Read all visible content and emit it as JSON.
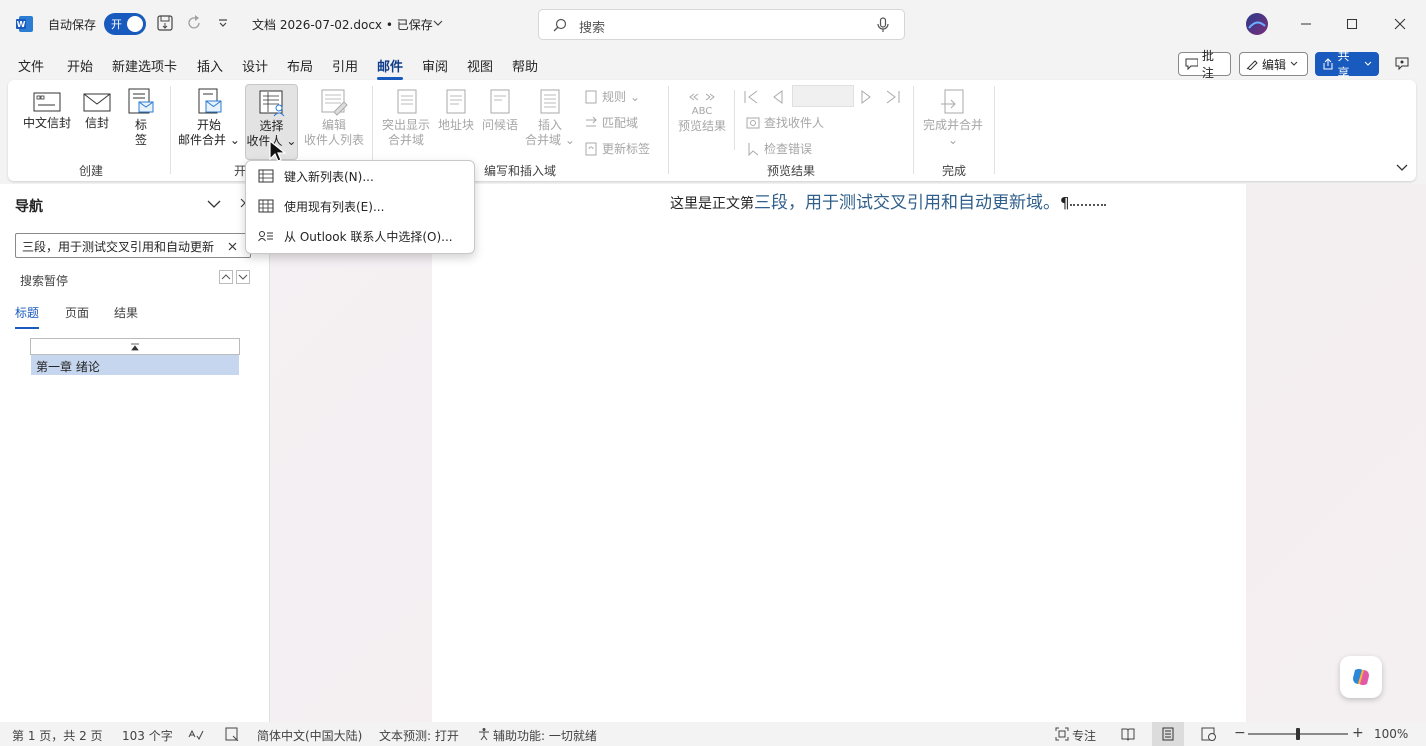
{
  "titlebar": {
    "autosave_label": "自动保存",
    "autosave_state": "开",
    "doc_title": "文档 2026-07-02.docx • 已保存",
    "search_placeholder": "搜索"
  },
  "menu": {
    "items": [
      "文件",
      "开始",
      "新建选项卡",
      "插入",
      "设计",
      "布局",
      "引用",
      "邮件",
      "审阅",
      "视图",
      "帮助"
    ],
    "active": "邮件",
    "comments_label": "批注",
    "editing_label": "编辑",
    "share_label": "共享"
  },
  "ribbon": {
    "create": {
      "group_name": "创建",
      "chinese_envelope": "中文信封",
      "envelope": "信封",
      "labels_1": "标",
      "labels_2": "签"
    },
    "start_merge": {
      "group_name_partial": "开",
      "start_1": "开始",
      "start_2": "邮件合并",
      "select_1": "选择",
      "select_2": "收件人",
      "edit_1": "编辑",
      "edit_2": "收件人列表"
    },
    "write_insert": {
      "group_name": "编写和插入域",
      "highlight_1": "突出显示",
      "highlight_2": "合并域",
      "address_block": "地址块",
      "greeting": "问候语",
      "insert_1": "插入",
      "insert_2": "合并域",
      "rules": "规则",
      "match_fields": "匹配域",
      "update_labels": "更新标签"
    },
    "preview": {
      "group_name": "预览结果",
      "abc": "ABC",
      "preview_results": "预览结果",
      "find_recipient": "查找收件人",
      "check_errors": "检查错误"
    },
    "finish": {
      "group_name": "完成",
      "finish_merge": "完成并合并"
    }
  },
  "dropdown": {
    "items": [
      "键入新列表(N)...",
      "使用现有列表(E)...",
      "从 Outlook 联系人中选择(O)..."
    ]
  },
  "nav": {
    "title": "导航",
    "search_value": "三段，用于测试交叉引用和自动更新",
    "results_label": "搜索暂停",
    "tabs": [
      "标题",
      "页面",
      "结果"
    ],
    "heading": "第一章 绪论"
  },
  "document": {
    "text_prefix": "这里是正文第",
    "text_highlight": "三段，用于测试交叉引用和自动更新域。",
    "pilcrow": "¶"
  },
  "status": {
    "page": "第 1 页，共 2 页",
    "words": "103 个字",
    "language": "简体中文(中国大陆)",
    "text_prediction": "文本预测: 打开",
    "accessibility": "辅助功能: 一切就绪",
    "focus": "专注",
    "zoom": "100%"
  },
  "colors": {
    "accent": "#185abd",
    "doc_highlight_text": "#2f5f8a",
    "nav_heading_bg": "#c6d6ee"
  }
}
